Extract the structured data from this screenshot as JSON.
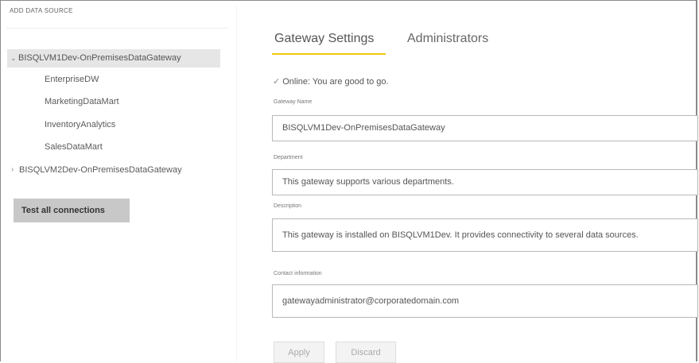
{
  "header": {
    "add_data_source": "ADD DATA SOURCE"
  },
  "tree": {
    "gateways": [
      {
        "name": "BISQLVM1Dev-OnPremisesDataGateway",
        "expanded": true,
        "children": [
          "EnterpriseDW",
          "MarketingDataMart",
          "InventoryAnalytics",
          "SalesDataMart"
        ]
      },
      {
        "name": "BISQLVM2Dev-OnPremisesDataGateway",
        "expanded": false
      }
    ],
    "test_button": "Test all connections"
  },
  "tabs": [
    {
      "label": "Gateway Settings",
      "active": true
    },
    {
      "label": "Administrators",
      "active": false
    }
  ],
  "status": {
    "icon": "check-icon",
    "text": "Online: You are good to go."
  },
  "form": {
    "gateway_name": {
      "label": "Gateway Name",
      "value": "BISQLVM1Dev-OnPremisesDataGateway"
    },
    "department": {
      "label": "Department",
      "value": "This gateway supports various departments."
    },
    "description": {
      "label": "Description",
      "value": "This gateway is installed on BISQLVM1Dev. It provides connectivity to several data sources."
    },
    "contact": {
      "label": "Contact information",
      "value": "gatewayadministrator@corporatedomain.com"
    }
  },
  "actions": {
    "apply": "Apply",
    "discard": "Discard"
  },
  "colors": {
    "accent": "#f2c80f",
    "selected_bg": "#e6e6e6",
    "button_bg": "#c8c8c8"
  }
}
